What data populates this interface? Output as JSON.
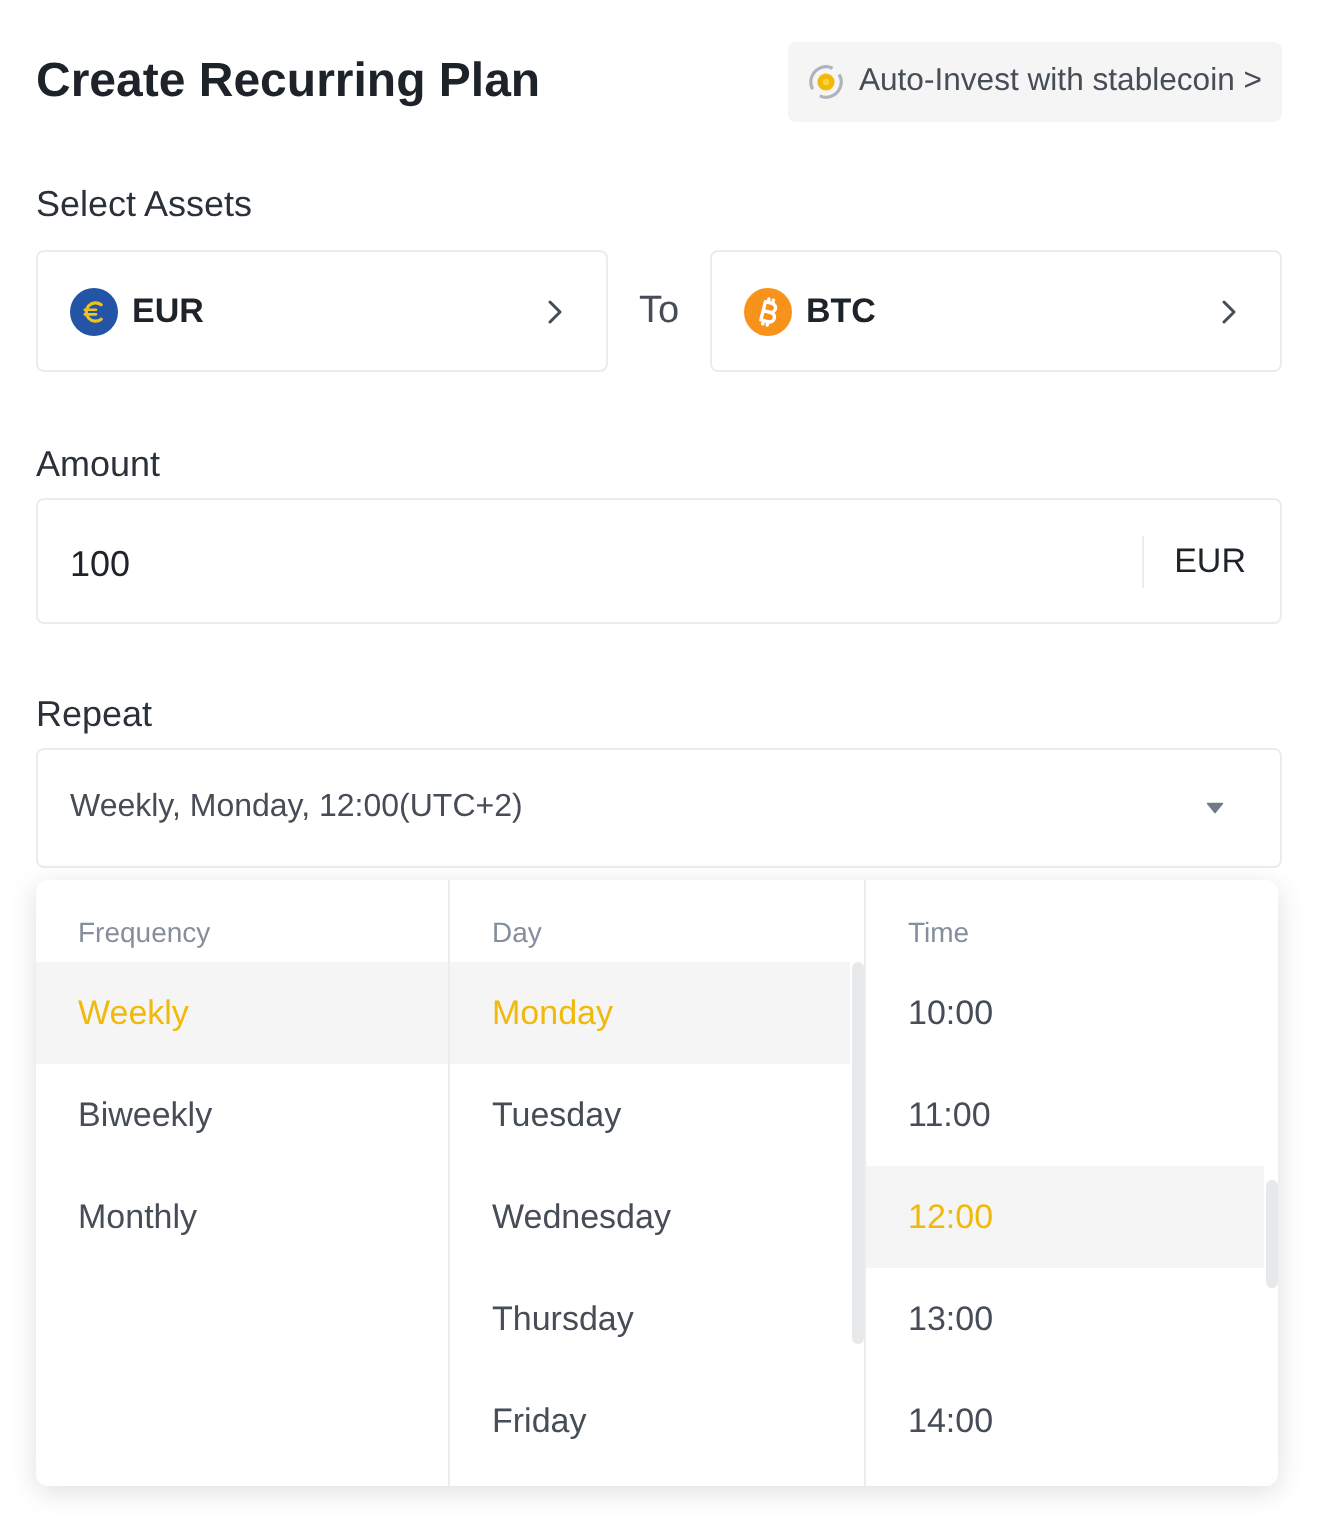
{
  "title": "Create Recurring Plan",
  "auto_invest_button": {
    "label": "Auto-Invest with stablecoin >"
  },
  "select_assets": {
    "label": "Select Assets",
    "from": {
      "symbol": "EUR",
      "kind": "euro"
    },
    "connector": "To",
    "to": {
      "symbol": "BTC",
      "kind": "bitcoin"
    }
  },
  "amount": {
    "label": "Amount",
    "value": "100",
    "currency": "EUR"
  },
  "repeat": {
    "label": "Repeat",
    "value": "Weekly, Monday, 12:00(UTC+2)",
    "expanded": true
  },
  "picker": {
    "columns": [
      {
        "heading": "Frequency",
        "options": [
          {
            "label": "Weekly",
            "selected": true
          },
          {
            "label": "Biweekly",
            "selected": false
          },
          {
            "label": "Monthly",
            "selected": false
          }
        ]
      },
      {
        "heading": "Day",
        "options": [
          {
            "label": "Monday",
            "selected": true
          },
          {
            "label": "Tuesday",
            "selected": false
          },
          {
            "label": "Wednesday",
            "selected": false
          },
          {
            "label": "Thursday",
            "selected": false
          },
          {
            "label": "Friday",
            "selected": false
          }
        ]
      },
      {
        "heading": "Time",
        "options": [
          {
            "label": "10:00",
            "selected": false
          },
          {
            "label": "11:00",
            "selected": false
          },
          {
            "label": "12:00",
            "selected": true
          },
          {
            "label": "13:00",
            "selected": false
          },
          {
            "label": "14:00",
            "selected": false
          }
        ]
      }
    ]
  }
}
